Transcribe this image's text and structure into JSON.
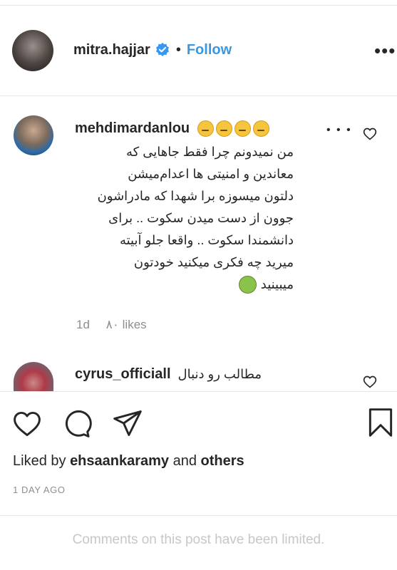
{
  "post_header": {
    "username": "mitra.hajjar",
    "separator": "•",
    "follow_label": "Follow",
    "more_glyph": "•••"
  },
  "comments": [
    {
      "username": "mehdimardanlou",
      "text_lines": [
        "من نمیدونم چرا فقط جاهایی که",
        "معاندین و امنیتی ها اعدام‌میشن",
        "دلتون میسوزه برا شهدا که مادراشون",
        "جوون از دست میدن سکوت .. برای",
        "دانشمندا سکوت .. واقعا جلو آبیته",
        "میرید چه فکری میکنید خودتون",
        "میبینید"
      ],
      "age": "1d",
      "likes": "۸۰ likes"
    },
    {
      "username": "cyrus_officiall",
      "text": "مطالب رو دنبال"
    }
  ],
  "actions": {
    "liked_prefix": "Liked by",
    "liked_user": "ehsaankaramy",
    "liked_and": "and",
    "liked_others": "others",
    "time_ago": "1 DAY AGO"
  },
  "footer": {
    "limited_notice": "Comments on this post have been limited."
  },
  "colors": {
    "follow": "#3a97e0",
    "verified": "#3897f0",
    "muted": "#8e8e8e",
    "limited": "#c7c7c7"
  }
}
